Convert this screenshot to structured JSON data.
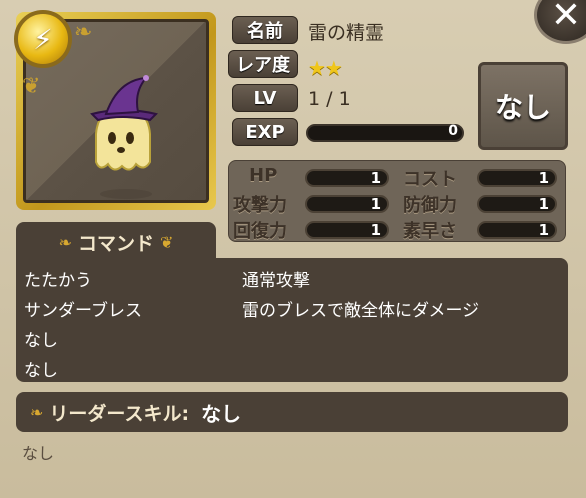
{
  "portrait": {
    "element_icon": "lightning-icon",
    "character_icon": "ghost-witch-hat-icon"
  },
  "labels": {
    "name": "名前",
    "rarity": "レア度",
    "level": "LV",
    "exp": "EXP"
  },
  "unit": {
    "name": "雷の精霊",
    "stars": "★★",
    "rarity_count": 2,
    "level": "1 / 1",
    "exp_value": "0",
    "exp_fraction": 0
  },
  "equip_button": "なし",
  "close_button": "✕",
  "stats": [
    {
      "label": "HP",
      "value": "1"
    },
    {
      "label": "コスト",
      "value": "1"
    },
    {
      "label": "攻撃力",
      "value": "1"
    },
    {
      "label": "防御力",
      "value": "1"
    },
    {
      "label": "回復力",
      "value": "1"
    },
    {
      "label": "素早さ",
      "value": "1"
    }
  ],
  "command": {
    "tab_label": "コマンド",
    "rows": [
      {
        "name": "たたかう",
        "desc": "通常攻撃"
      },
      {
        "name": "サンダーブレス",
        "desc": "雷のブレスで敵全体にダメージ"
      },
      {
        "name": "なし",
        "desc": ""
      },
      {
        "name": "なし",
        "desc": ""
      }
    ]
  },
  "leader_skill": {
    "label": "リーダースキル:",
    "value": "なし",
    "description": "なし"
  },
  "colors": {
    "background": "#d2c6a8",
    "panel_dark": "#4a4036",
    "gold_accent": "#e0b828",
    "star": "#f0c61a"
  }
}
